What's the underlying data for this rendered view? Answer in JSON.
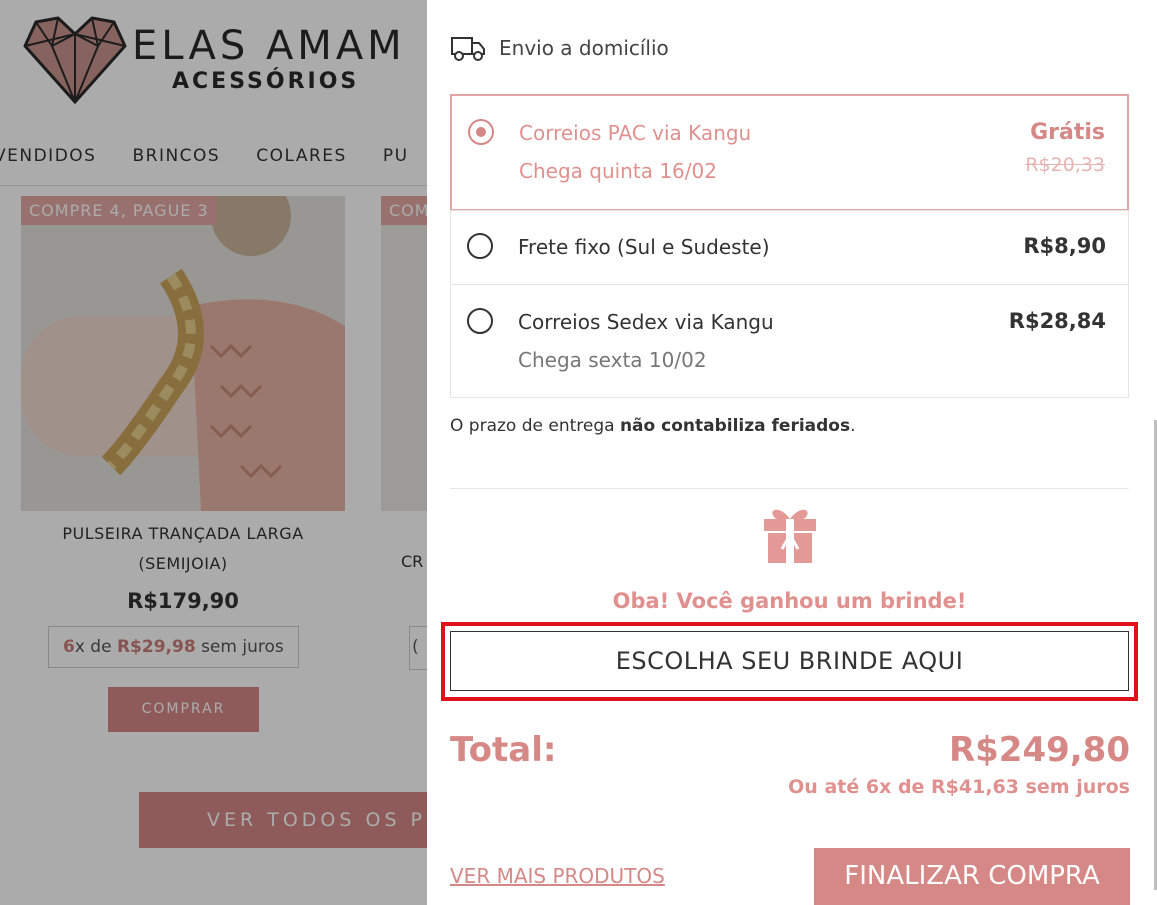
{
  "store": {
    "logo": {
      "line1": "ELAS AMAM",
      "line2": "ACESSÓRIOS"
    },
    "nav": [
      "VENDIDOS",
      "BRINCOS",
      "COLARES",
      "PU"
    ],
    "products": [
      {
        "promo": "COMPRE 4, PAGUE 3",
        "name": "PULSEIRA TRANÇADA LARGA (SEMIJOIA)",
        "price": "R$179,90",
        "installments": {
          "count": "6",
          "mid": "x de",
          "amount": "R$29,98",
          "suffix": "sem juros"
        },
        "buy_label": "COMPRAR"
      },
      {
        "promo": "COM",
        "name": "CR",
        "installment_fragment": "(",
        "buy_label": ""
      }
    ],
    "view_all_label": "VER TODOS OS PRO"
  },
  "cart": {
    "shipping_heading": "Envio a domicílio",
    "shipping_options": [
      {
        "title": "Correios PAC via Kangu",
        "subtitle": "Chega quinta 16/02",
        "price": "Grátis",
        "old_price": "R$20,33",
        "selected": true
      },
      {
        "title": "Frete fixo (Sul e Sudeste)",
        "subtitle": "",
        "price": "R$8,90",
        "selected": false
      },
      {
        "title": "Correios Sedex via Kangu",
        "subtitle": "Chega sexta 10/02",
        "price": "R$28,84",
        "selected": false
      }
    ],
    "note": {
      "prefix": "O prazo de entrega ",
      "bold": "não contabiliza feriados",
      "suffix": "."
    },
    "gift_message": "Oba! Você ganhou um brinde!",
    "gift_button": "ESCOLHA SEU BRINDE AQUI",
    "total_label": "Total:",
    "total_value": "R$249,80",
    "total_installments": "Ou até 6x de R$41,63 sem juros",
    "more_products_link": "VER MAIS PRODUTOS",
    "checkout_button": "FINALIZAR COMPRA"
  },
  "colors": {
    "accent": "#d68886",
    "accent_light": "#e0918f",
    "highlight": "#e0111a"
  },
  "icons": [
    "heart-logo-icon",
    "truck-icon",
    "gift-icon"
  ]
}
